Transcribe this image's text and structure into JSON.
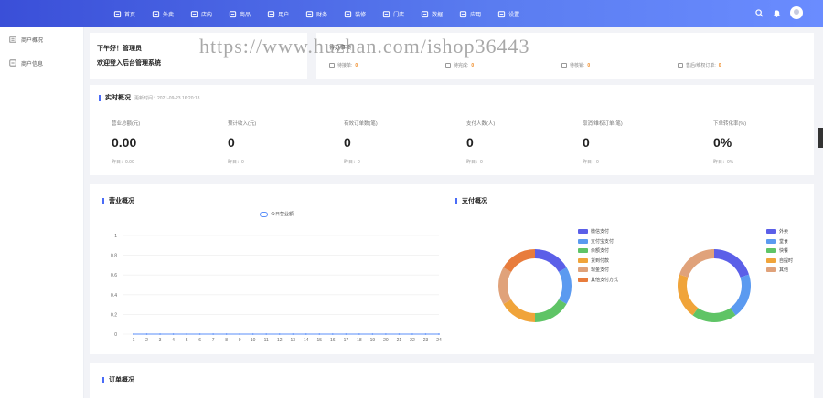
{
  "nav": {
    "items": [
      {
        "label": "首页",
        "icon": "home-icon"
      },
      {
        "label": "外卖",
        "icon": "delivery-icon"
      },
      {
        "label": "店内",
        "icon": "dine-in-icon"
      },
      {
        "label": "商品",
        "icon": "product-icon"
      },
      {
        "label": "用户",
        "icon": "user-icon"
      },
      {
        "label": "财务",
        "icon": "finance-icon"
      },
      {
        "label": "装修",
        "icon": "decorate-icon"
      },
      {
        "label": "门店",
        "icon": "store-icon"
      },
      {
        "label": "数据",
        "icon": "data-icon"
      },
      {
        "label": "应用",
        "icon": "apps-icon"
      },
      {
        "label": "设置",
        "icon": "settings-icon"
      }
    ]
  },
  "sidebar": {
    "items": [
      {
        "label": "商户概况",
        "icon": "overview-icon"
      },
      {
        "label": "商户信息",
        "icon": "info-icon"
      }
    ]
  },
  "watermark": "https://www.huzhan.com/ishop36443",
  "welcome": {
    "line1": "下午好！管理员",
    "line2": "欢迎登入后台管理系统"
  },
  "todo": {
    "title": "待办事项",
    "items": [
      {
        "label": "待接单:",
        "value": "0"
      },
      {
        "label": "待完成:",
        "value": "0"
      },
      {
        "label": "待核销:",
        "value": "0"
      },
      {
        "label": "售后/维权订单:",
        "value": "0"
      }
    ]
  },
  "realtime": {
    "title": "实时概况",
    "updated": "更新时间：2021-09-23 16:20:18",
    "stats": [
      {
        "label": "营业总额(元)",
        "value": "0.00",
        "yesterday": "昨日：0.00"
      },
      {
        "label": "预计收入(元)",
        "value": "0",
        "yesterday": "昨日：0"
      },
      {
        "label": "有效订单数(笔)",
        "value": "0",
        "yesterday": "昨日：0"
      },
      {
        "label": "支付人数(人)",
        "value": "0",
        "yesterday": "昨日：0"
      },
      {
        "label": "取消/维权订单(笔)",
        "value": "0",
        "yesterday": "昨日：0"
      },
      {
        "label": "下单转化率(%)",
        "value": "0%",
        "yesterday": "昨日：0%"
      }
    ]
  },
  "business": {
    "title": "营业概况",
    "legend": "今日营业额"
  },
  "payment": {
    "title": "支付概况"
  },
  "orders": {
    "title": "订单概况"
  },
  "chart_data": [
    {
      "type": "line",
      "title": "",
      "series": [
        {
          "name": "今日营业额",
          "values": [
            0,
            0,
            0,
            0,
            0,
            0,
            0,
            0,
            0,
            0,
            0,
            0,
            0,
            0,
            0,
            0,
            0,
            0,
            0,
            0,
            0,
            0,
            0,
            0
          ]
        }
      ],
      "x": [
        1,
        2,
        3,
        4,
        5,
        6,
        7,
        8,
        9,
        10,
        11,
        12,
        13,
        14,
        15,
        16,
        17,
        18,
        19,
        20,
        21,
        22,
        23,
        24
      ],
      "yticks": [
        "0",
        "0.2",
        "0.4",
        "0.6",
        "0.8",
        "1"
      ],
      "ylim": [
        0,
        1
      ],
      "grid": true,
      "color": "#5b8ff9"
    },
    {
      "type": "pie",
      "donut": true,
      "labels": [
        "微信支付",
        "支付宝支付",
        "余额支付",
        "货到付款",
        "现金支付",
        "其他支付方式"
      ],
      "values": [
        1,
        1,
        1,
        1,
        1,
        1
      ],
      "colors": [
        "#5b5fe8",
        "#5b9af0",
        "#5fc466",
        "#f0a43a",
        "#e0a27a",
        "#e87c3c"
      ]
    },
    {
      "type": "pie",
      "donut": true,
      "labels": [
        "外卖",
        "堂食",
        "快餐",
        "自提时",
        "其他"
      ],
      "values": [
        1,
        1,
        1,
        1,
        1
      ],
      "colors": [
        "#5b5fe8",
        "#5b9af0",
        "#5fc466",
        "#f0a43a",
        "#e0a27a"
      ]
    }
  ]
}
